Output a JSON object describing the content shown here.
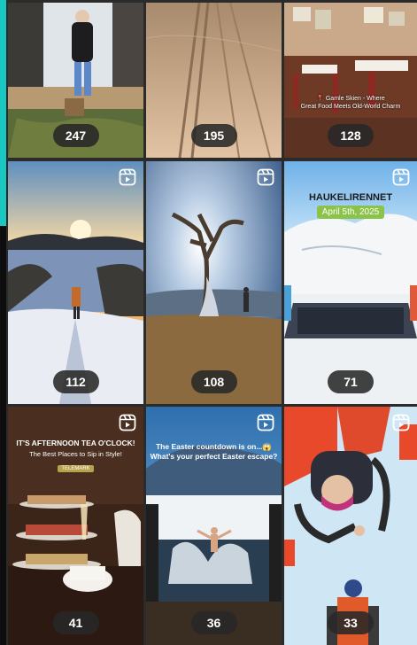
{
  "tiles": [
    {
      "count": "247",
      "reel": false
    },
    {
      "count": "195",
      "reel": false
    },
    {
      "count": "128",
      "reel": false,
      "caption_line1": "📍 Gamle Skien - Where",
      "caption_line2": "Great Food Meets Old-World Charm"
    },
    {
      "count": "112",
      "reel": true
    },
    {
      "count": "108",
      "reel": true
    },
    {
      "count": "71",
      "reel": true,
      "event_name": "HAUKELIRENNET",
      "event_date": "April 5th, 2025"
    },
    {
      "count": "41",
      "reel": true,
      "title": "IT'S AFTERNOON TEA O'CLOCK!",
      "subtitle": "The Best Places to Sip in Style!",
      "tag": "TELEMARK"
    },
    {
      "count": "36",
      "reel": true,
      "line1": "The Easter countdown is on...😱",
      "line2": "What's your perfect Easter escape?"
    },
    {
      "count": "33",
      "reel": true
    }
  ]
}
